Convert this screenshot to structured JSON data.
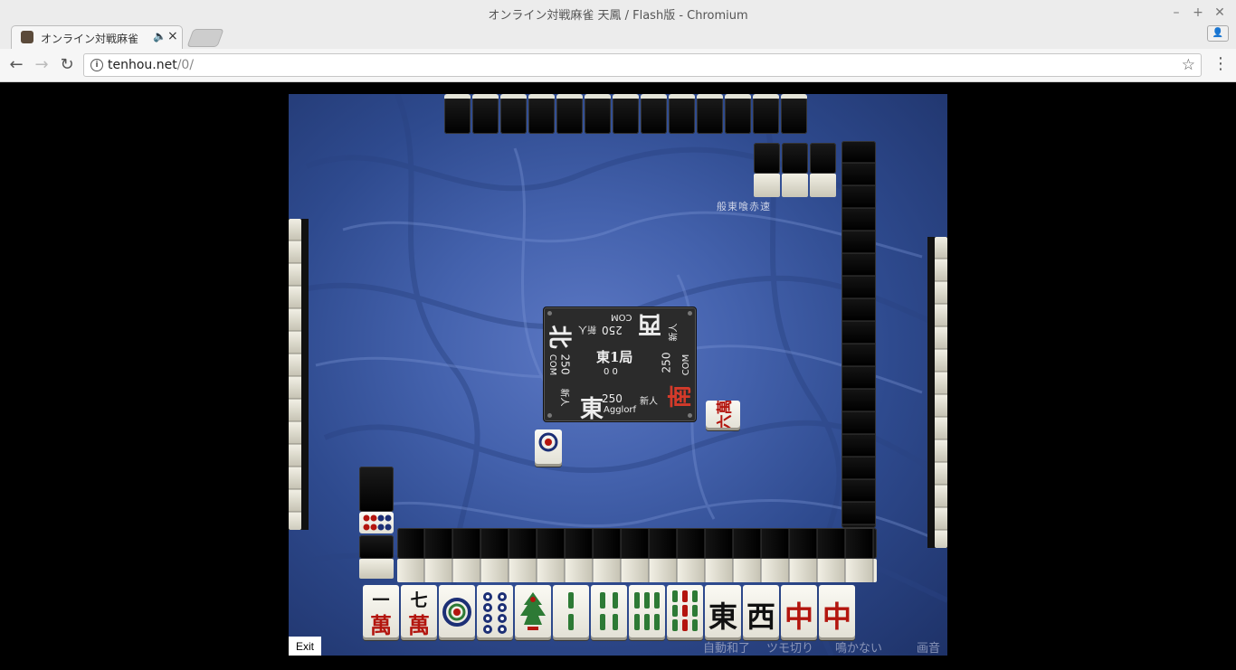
{
  "window": {
    "title": "オンライン対戦麻雀 天鳳 / Flash版 - Chromium"
  },
  "tab": {
    "title": "オンライン対戦麻雀 天",
    "audio_icon": "speaker-icon",
    "close": "×"
  },
  "address": {
    "host": "tenhou.net",
    "path": "/0/"
  },
  "game": {
    "round": "東1局",
    "honba_counts": "0  0",
    "players": {
      "self": {
        "wind": "東",
        "score": "250",
        "name": "Agglorf",
        "rank": "新人"
      },
      "right": {
        "wind": "南",
        "score": "250",
        "name": "COM",
        "rank": "新人"
      },
      "top": {
        "wind": "西",
        "score": "250",
        "name": "COM",
        "rank": "新人"
      },
      "left": {
        "wind": "北",
        "score": "250",
        "name": "COM",
        "rank": "新人"
      }
    },
    "rules_label": "般東喰赤速",
    "hand": [
      "一萬",
      "七萬",
      "1p",
      "8p",
      "1s",
      "2s",
      "4s",
      "6s",
      "9s",
      "東",
      "西",
      "中",
      "中"
    ],
    "right_discard": "六萬",
    "exit_label": "Exit",
    "options": {
      "auto_win": "自動和了",
      "tsumogiri": "ツモ切り",
      "no_call": "鳴かない",
      "sound": "画音"
    }
  },
  "colors": {
    "table": "#3f5ca8",
    "red_tile": "#b3150e"
  }
}
